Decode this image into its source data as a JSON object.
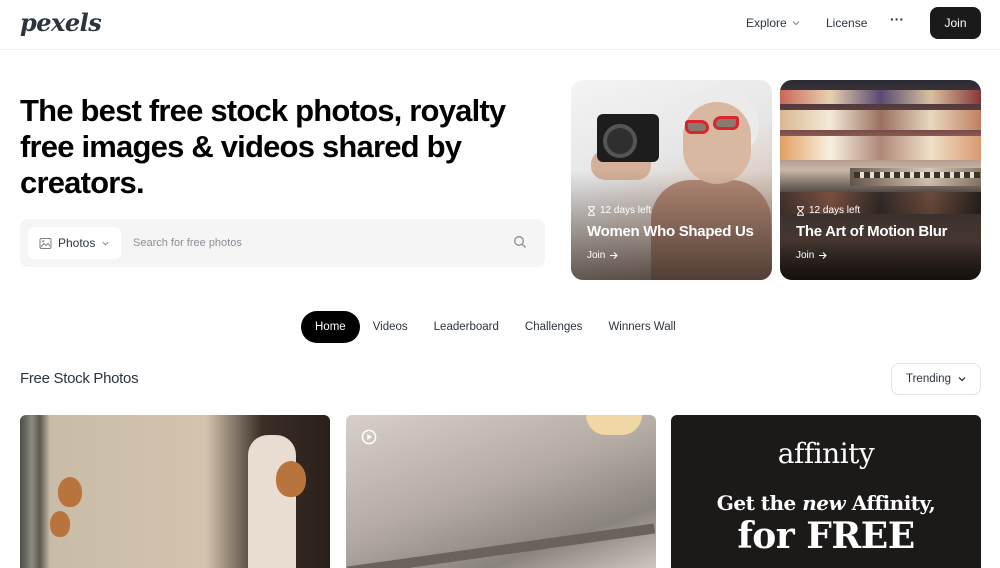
{
  "header": {
    "logo": "pexels",
    "nav": {
      "explore": "Explore",
      "license": "License",
      "more": "···"
    },
    "join": "Join"
  },
  "hero": {
    "title": "The best free stock photos, royalty free images & videos shared by creators.",
    "search": {
      "type_selected": "Photos",
      "placeholder": "Search for free photos",
      "value": ""
    }
  },
  "challenges": [
    {
      "countdown": "12 days left",
      "title": "Women Who Shaped Us",
      "cta": "Join"
    },
    {
      "countdown": "12 days left",
      "title": "The Art of Motion Blur",
      "cta": "Join"
    }
  ],
  "tabs": [
    {
      "label": "Home",
      "active": true
    },
    {
      "label": "Videos",
      "active": false
    },
    {
      "label": "Leaderboard",
      "active": false
    },
    {
      "label": "Challenges",
      "active": false
    },
    {
      "label": "Winners Wall",
      "active": false
    }
  ],
  "feed": {
    "title": "Free Stock Photos",
    "sort": "Trending"
  },
  "ad": {
    "brand": "affinity",
    "line1_pre": "Get the ",
    "line1_em": "new",
    "line1_post": " Affinity,",
    "line2": "for FREE"
  },
  "icons": {
    "explore_chevron": "chevron-down-icon",
    "image_type": "image-icon",
    "search": "search-icon",
    "hourglass": "hourglass-icon",
    "arrow": "arrow-right-icon",
    "sort_chevron": "chevron-down-icon",
    "video": "play-circle-icon"
  },
  "colors": {
    "join_bg": "#1a1a1a",
    "search_bg": "#f5f5f5",
    "active_tab": "#000000",
    "ad_bg": "#1c1a19"
  }
}
